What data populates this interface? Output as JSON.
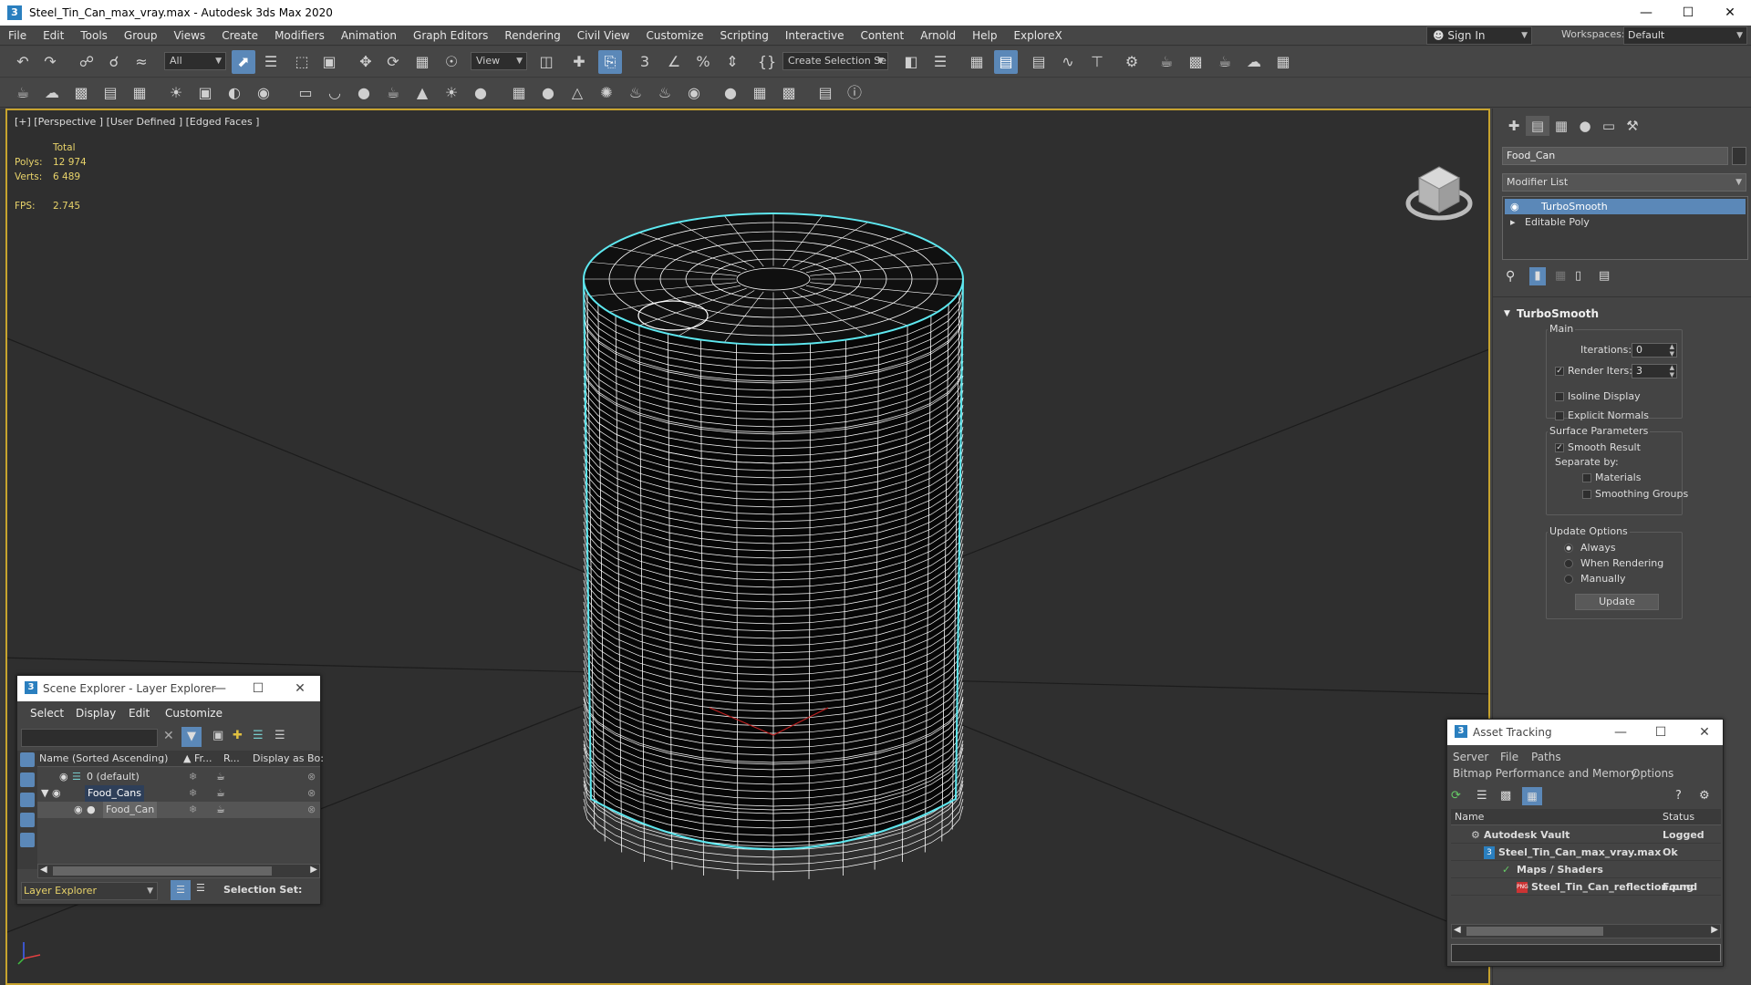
{
  "window": {
    "title": "Steel_Tin_Can_max_vray.max - Autodesk 3ds Max 2020",
    "app_icon": "3",
    "controls": [
      "minimize",
      "maximize",
      "close"
    ]
  },
  "menu": [
    "File",
    "Edit",
    "Tools",
    "Group",
    "Views",
    "Create",
    "Modifiers",
    "Animation",
    "Graph Editors",
    "Rendering",
    "Civil View",
    "Customize",
    "Scripting",
    "Interactive",
    "Content",
    "Arnold",
    "Help",
    "ExploreX"
  ],
  "account": {
    "sign_in": "Sign In",
    "workspaces_label": "Workspaces:",
    "workspace": "Default"
  },
  "toolbar": {
    "selection_filter": "All",
    "ref_coord": "View",
    "named_selection": "Create Selection Se"
  },
  "viewport": {
    "label": "[+] [Perspective ] [User Defined ] [Edged Faces ]",
    "stats": {
      "total_label": "Total",
      "polys_label": "Polys:",
      "polys": "12 974",
      "verts_label": "Verts:",
      "verts": "6 489",
      "fps_label": "FPS:",
      "fps": "2.745"
    },
    "colors": {
      "background": "#2f2f2f",
      "grid": "#1c1c1c",
      "wire": "#ffffff",
      "selection": "#5ee8f0",
      "active_border": "#c7a32e"
    }
  },
  "command_panel": {
    "object_name": "Food_Can",
    "modifier_list": "Modifier List",
    "stack": [
      {
        "label": "TurboSmooth",
        "selected": true
      },
      {
        "label": "Editable Poly",
        "selected": false
      }
    ],
    "rollout": {
      "title": "TurboSmooth",
      "main_label": "Main",
      "iterations_label": "Iterations:",
      "iterations": "0",
      "render_iters_label": "Render Iters:",
      "render_iters": "3",
      "render_iters_checked": true,
      "isoline_display": "Isoline Display",
      "explicit_normals": "Explicit Normals",
      "surface_params_label": "Surface Parameters",
      "smooth_result": "Smooth Result",
      "smooth_result_checked": true,
      "separate_by_label": "Separate by:",
      "materials": "Materials",
      "smoothing_groups": "Smoothing Groups",
      "update_options_label": "Update Options",
      "always": "Always",
      "when_rendering": "When Rendering",
      "manually": "Manually",
      "update_button": "Update"
    }
  },
  "scene_explorer": {
    "title": "Scene Explorer - Layer Explorer",
    "menu": [
      "Select",
      "Display",
      "Edit",
      "Customize"
    ],
    "columns": [
      "Name (Sorted Ascending)",
      "▲ Fr...",
      "R...",
      "Display as Bo:"
    ],
    "rows": [
      {
        "name": "0 (default)",
        "indent": 1
      },
      {
        "name": "Food_Cans",
        "indent": 1
      },
      {
        "name": "Food_Can",
        "indent": 2
      }
    ],
    "footer_explorer": "Layer Explorer",
    "footer_selection_set": "Selection Set:"
  },
  "asset_tracking": {
    "title": "Asset Tracking",
    "menu1": [
      "Server",
      "File",
      "Paths"
    ],
    "menu2": [
      "Bitmap Performance and Memory",
      "Options"
    ],
    "columns": [
      "Name",
      "Status"
    ],
    "rows": [
      {
        "name": "Autodesk Vault",
        "status": "Logged"
      },
      {
        "name": "Steel_Tin_Can_max_vray.max",
        "status": "Ok"
      },
      {
        "name": "Maps / Shaders",
        "status": ""
      },
      {
        "name": "Steel_Tin_Can_reflection.png",
        "status": "Found"
      }
    ]
  }
}
